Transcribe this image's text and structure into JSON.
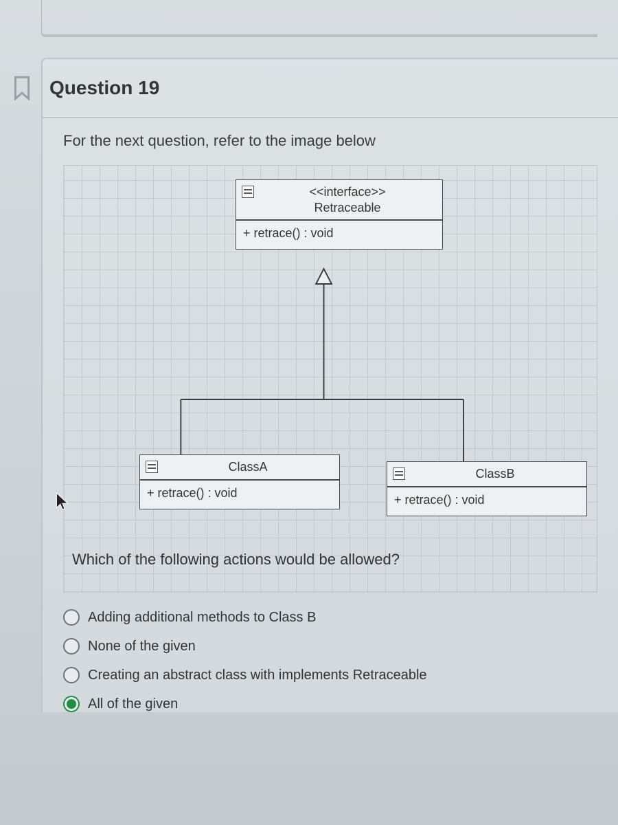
{
  "header": {
    "title": "Question 19"
  },
  "instruction": "For the next question, refer to the image below",
  "uml": {
    "interface": {
      "stereotype": "<<interface>>",
      "name": "Retraceable",
      "op": "+ retrace() : void"
    },
    "classA": {
      "name": "ClassA",
      "op": "+ retrace() : void"
    },
    "classB": {
      "name": "ClassB",
      "op": "+ retrace() : void"
    }
  },
  "question": "Which of the following actions would be allowed?",
  "options": [
    {
      "label": "Adding additional methods to Class B",
      "selected": false
    },
    {
      "label": "None of the given",
      "selected": false
    },
    {
      "label": "Creating an abstract class with implements Retraceable",
      "selected": false
    },
    {
      "label": "All of the given",
      "selected": true
    }
  ]
}
